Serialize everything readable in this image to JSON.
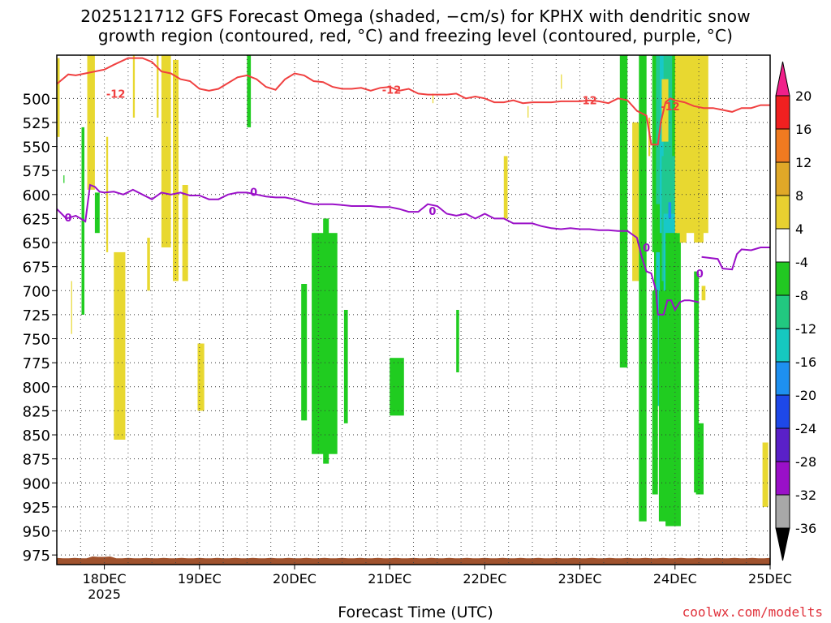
{
  "title_line1": "2025121712 GFS Forecast Omega (shaded, −cm/s) for KPHX with dendritic snow",
  "title_line2": "growth region (contoured, red, °C) and freezing level (contoured, purple, °C)",
  "xlabel": "Forecast Time (UTC)",
  "credit": "coolwx.com/modelts",
  "chart_data": {
    "type": "heatmap",
    "y_axis": {
      "type": "pressure_hPa",
      "range": [
        455,
        985
      ],
      "inverted": true,
      "ticks": [
        500,
        525,
        550,
        575,
        600,
        625,
        650,
        675,
        700,
        725,
        750,
        775,
        800,
        825,
        850,
        875,
        900,
        925,
        950,
        975
      ]
    },
    "x_axis": {
      "unit": "days since 2025-12-18 00Z",
      "range": [
        -0.5,
        7.0
      ],
      "ticks": [
        {
          "x": 0,
          "label": "18DEC",
          "sublabel": "2025"
        },
        {
          "x": 1,
          "label": "19DEC"
        },
        {
          "x": 2,
          "label": "20DEC"
        },
        {
          "x": 3,
          "label": "21DEC"
        },
        {
          "x": 4,
          "label": "22DEC"
        },
        {
          "x": 5,
          "label": "23DEC"
        },
        {
          "x": 6,
          "label": "24DEC"
        },
        {
          "x": 7,
          "label": "25DEC"
        }
      ]
    },
    "grid": true,
    "colorbar": {
      "labels": [
        "20",
        "16",
        "12",
        "8",
        "4",
        "-4",
        "-8",
        "-12",
        "-16",
        "-20",
        "-24",
        "-28",
        "-32",
        "-36"
      ],
      "colors": [
        "#f02020",
        "#f07a20",
        "#e0a828",
        "#e8d030",
        "#ffffff",
        "#22c822",
        "#22c880",
        "#16c8c0",
        "#1e90f0",
        "#1e48e8",
        "#5a20c8",
        "#9a10c8",
        "#a8a8a8"
      ],
      "top_color": "#f0208a",
      "bottom_color": "#000000"
    },
    "shading_colors": {
      "yellow": "#e8d830",
      "green": "#20cc20",
      "teal": "#20c890",
      "cyan": "#18c8c8",
      "blue": "#2090f0",
      "ground": "#a0522d"
    },
    "shaded_regions": [
      {
        "c": "yellow",
        "x": [
          -0.5,
          -0.47
        ],
        "p": [
          458,
          540
        ]
      },
      {
        "c": "yellow",
        "x": [
          -0.18,
          -0.1
        ],
        "p": [
          455,
          595
        ]
      },
      {
        "c": "green",
        "x": [
          -0.24,
          -0.21
        ],
        "p": [
          530,
          725
        ]
      },
      {
        "c": "green",
        "x": [
          -0.1,
          -0.05
        ],
        "p": [
          598,
          640
        ]
      },
      {
        "c": "green",
        "x": [
          -0.43,
          -0.42
        ],
        "p": [
          580,
          588
        ]
      },
      {
        "c": "yellow",
        "x": [
          -0.35,
          -0.34
        ],
        "p": [
          690,
          745
        ]
      },
      {
        "c": "yellow",
        "x": [
          0.02,
          0.04
        ],
        "p": [
          540,
          660
        ]
      },
      {
        "c": "yellow",
        "x": [
          0.1,
          0.22
        ],
        "p": [
          660,
          855
        ]
      },
      {
        "c": "yellow",
        "x": [
          0.3,
          0.32
        ],
        "p": [
          455,
          520
        ]
      },
      {
        "c": "yellow",
        "x": [
          0.45,
          0.48
        ],
        "p": [
          645,
          700
        ]
      },
      {
        "c": "yellow",
        "x": [
          0.55,
          0.57
        ],
        "p": [
          455,
          520
        ]
      },
      {
        "c": "yellow",
        "x": [
          0.6,
          0.7
        ],
        "p": [
          455,
          655
        ]
      },
      {
        "c": "yellow",
        "x": [
          0.72,
          0.78
        ],
        "p": [
          460,
          690
        ]
      },
      {
        "c": "yellow",
        "x": [
          0.82,
          0.88
        ],
        "p": [
          590,
          690
        ]
      },
      {
        "c": "yellow",
        "x": [
          0.98,
          1.05
        ],
        "p": [
          755,
          825
        ]
      },
      {
        "c": "green",
        "x": [
          1.5,
          1.54
        ],
        "p": [
          455,
          530
        ]
      },
      {
        "c": "green",
        "x": [
          2.07,
          2.13
        ],
        "p": [
          693,
          835
        ]
      },
      {
        "c": "green",
        "x": [
          2.18,
          2.45
        ],
        "p": [
          640,
          870
        ]
      },
      {
        "c": "green",
        "x": [
          2.3,
          2.36
        ],
        "p": [
          625,
          880
        ]
      },
      {
        "c": "green",
        "x": [
          2.52,
          2.56
        ],
        "p": [
          720,
          838
        ]
      },
      {
        "c": "green",
        "x": [
          3.0,
          3.15
        ],
        "p": [
          770,
          830
        ]
      },
      {
        "c": "green",
        "x": [
          3.7,
          3.73
        ],
        "p": [
          720,
          785
        ]
      },
      {
        "c": "yellow",
        "x": [
          4.2,
          4.24
        ],
        "p": [
          560,
          625
        ]
      },
      {
        "c": "yellow",
        "x": [
          3.45,
          3.46
        ],
        "p": [
          495,
          505
        ]
      },
      {
        "c": "yellow",
        "x": [
          4.45,
          4.46
        ],
        "p": [
          508,
          520
        ]
      },
      {
        "c": "yellow",
        "x": [
          4.8,
          4.81
        ],
        "p": [
          475,
          490
        ]
      },
      {
        "c": "green",
        "x": [
          5.42,
          5.5
        ],
        "p": [
          455,
          780
        ]
      },
      {
        "c": "yellow",
        "x": [
          5.55,
          5.62
        ],
        "p": [
          525,
          690
        ]
      },
      {
        "c": "green",
        "x": [
          5.62,
          5.7
        ],
        "p": [
          455,
          940
        ]
      },
      {
        "c": "yellow",
        "x": [
          5.72,
          5.74
        ],
        "p": [
          520,
          560
        ]
      },
      {
        "c": "green",
        "x": [
          5.76,
          5.8
        ],
        "p": [
          455,
          660
        ]
      },
      {
        "c": "green",
        "x": [
          5.78,
          6.02
        ],
        "p": [
          455,
          780
        ]
      },
      {
        "c": "teal",
        "x": [
          5.8,
          5.97
        ],
        "p": [
          455,
          610
        ]
      },
      {
        "c": "cyan",
        "x": [
          5.84,
          5.88
        ],
        "p": [
          455,
          640
        ]
      },
      {
        "c": "yellow",
        "x": [
          5.86,
          5.93
        ],
        "p": [
          480,
          545
        ]
      },
      {
        "c": "teal",
        "x": [
          5.86,
          6.0
        ],
        "p": [
          560,
          690
        ]
      },
      {
        "c": "cyan",
        "x": [
          5.88,
          6.0
        ],
        "p": [
          620,
          780
        ]
      },
      {
        "c": "blue",
        "x": [
          5.93,
          5.96
        ],
        "p": [
          608,
          625
        ]
      },
      {
        "c": "cyan",
        "x": [
          5.8,
          5.84
        ],
        "p": [
          660,
          820
        ]
      },
      {
        "c": "green",
        "x": [
          5.76,
          5.82
        ],
        "p": [
          700,
          912
        ]
      },
      {
        "c": "green",
        "x": [
          5.83,
          5.92
        ],
        "p": [
          700,
          940
        ]
      },
      {
        "c": "teal",
        "x": [
          5.95,
          6.06
        ],
        "p": [
          700,
          800
        ]
      },
      {
        "c": "green",
        "x": [
          5.9,
          6.06
        ],
        "p": [
          640,
          945
        ]
      },
      {
        "c": "yellow",
        "x": [
          6.0,
          6.35
        ],
        "p": [
          455,
          640
        ]
      },
      {
        "c": "yellow",
        "x": [
          6.05,
          6.12
        ],
        "p": [
          620,
          650
        ]
      },
      {
        "c": "yellow",
        "x": [
          6.2,
          6.3
        ],
        "p": [
          460,
          650
        ]
      },
      {
        "c": "yellow",
        "x": [
          6.28,
          6.32
        ],
        "p": [
          695,
          710
        ]
      },
      {
        "c": "green",
        "x": [
          6.2,
          6.25
        ],
        "p": [
          680,
          910
        ]
      },
      {
        "c": "green",
        "x": [
          6.22,
          6.3
        ],
        "p": [
          838,
          912
        ]
      },
      {
        "c": "yellow",
        "x": [
          6.92,
          6.98
        ],
        "p": [
          858,
          925
        ]
      }
    ],
    "series": [
      {
        "name": "-12",
        "color": "#f04040",
        "label_positions": [
          [
            0.12,
            495
          ],
          [
            3.02,
            491
          ],
          [
            5.08,
            502
          ],
          [
            5.95,
            508
          ]
        ],
        "x": [
          -0.5,
          -0.38,
          -0.3,
          -0.2,
          -0.1,
          0.0,
          0.1,
          0.25,
          0.4,
          0.5,
          0.6,
          0.7,
          0.8,
          0.9,
          1.0,
          1.1,
          1.2,
          1.3,
          1.4,
          1.5,
          1.6,
          1.7,
          1.8,
          1.9,
          2.0,
          2.1,
          2.2,
          2.3,
          2.4,
          2.5,
          2.6,
          2.7,
          2.8,
          2.9,
          3.0,
          3.1,
          3.2,
          3.3,
          3.4,
          3.5,
          3.6,
          3.7,
          3.8,
          3.9,
          4.0,
          4.1,
          4.2,
          4.3,
          4.4,
          4.5,
          4.6,
          4.7,
          4.8,
          4.9,
          5.0,
          5.1,
          5.2,
          5.3,
          5.4,
          5.5,
          5.6,
          5.7,
          5.75,
          5.8,
          5.82,
          5.85,
          5.9,
          5.95,
          6.0,
          6.1,
          6.2,
          6.3,
          6.4,
          6.5,
          6.6,
          6.7,
          6.8,
          6.9,
          7.0
        ],
        "y": [
          485,
          475,
          476,
          474,
          472,
          470,
          465,
          458,
          458,
          462,
          472,
          474,
          480,
          482,
          490,
          492,
          490,
          484,
          478,
          476,
          480,
          488,
          491,
          480,
          474,
          476,
          482,
          483,
          488,
          490,
          490,
          489,
          492,
          489,
          488,
          492,
          490,
          495,
          496,
          496,
          496,
          495,
          500,
          498,
          500,
          504,
          504,
          502,
          505,
          504,
          504,
          504,
          503,
          503,
          503,
          502,
          503,
          505,
          500,
          502,
          513,
          518,
          548,
          548,
          548,
          525,
          504,
          500,
          502,
          504,
          508,
          510,
          510,
          512,
          514,
          510,
          510,
          507,
          507
        ]
      },
      {
        "name": "0",
        "color": "#9a10c8",
        "label_positions": [
          [
            -0.38,
            624
          ],
          [
            1.57,
            597
          ],
          [
            3.45,
            617
          ],
          [
            5.7,
            655
          ],
          [
            6.26,
            682
          ]
        ],
        "x": [
          -0.5,
          -0.45,
          -0.4,
          -0.3,
          -0.2,
          -0.15,
          -0.1,
          -0.05,
          0.0,
          0.1,
          0.2,
          0.3,
          0.4,
          0.5,
          0.6,
          0.7,
          0.8,
          0.9,
          1.0,
          1.1,
          1.2,
          1.3,
          1.4,
          1.5,
          1.6,
          1.7,
          1.8,
          1.9,
          2.0,
          2.1,
          2.2,
          2.3,
          2.4,
          2.5,
          2.6,
          2.7,
          2.8,
          2.9,
          3.0,
          3.1,
          3.2,
          3.3,
          3.4,
          3.5,
          3.6,
          3.7,
          3.8,
          3.9,
          4.0,
          4.1,
          4.2,
          4.3,
          4.4,
          4.5,
          4.6,
          4.7,
          4.8,
          4.9,
          5.0,
          5.1,
          5.2,
          5.3,
          5.4,
          5.5,
          5.6,
          5.65,
          5.7,
          5.75,
          5.8,
          5.82,
          5.88,
          5.92,
          5.96,
          6.0,
          6.05,
          6.1,
          6.15,
          6.2,
          6.25
        ],
        "y": [
          615,
          620,
          625,
          622,
          628,
          590,
          592,
          597,
          598,
          597,
          600,
          595,
          600,
          605,
          598,
          600,
          598,
          601,
          601,
          605,
          605,
          600,
          598,
          598,
          600,
          602,
          603,
          603,
          605,
          608,
          610,
          610,
          610,
          611,
          612,
          612,
          612,
          613,
          613,
          615,
          618,
          618,
          610,
          612,
          620,
          622,
          620,
          625,
          620,
          625,
          625,
          630,
          630,
          630,
          633,
          635,
          636,
          635,
          636,
          636,
          637,
          637,
          638,
          638,
          645,
          665,
          680,
          682,
          700,
          725,
          725,
          710,
          710,
          720,
          712,
          710,
          710,
          711,
          712
        ]
      },
      {
        "name": "0b",
        "color": "#9a10c8",
        "x": [
          6.28,
          6.45,
          6.5,
          6.6,
          6.65,
          6.7,
          6.8,
          6.9,
          7.0
        ],
        "y": [
          665,
          667,
          677,
          678,
          662,
          657,
          658,
          655,
          655
        ]
      }
    ]
  }
}
